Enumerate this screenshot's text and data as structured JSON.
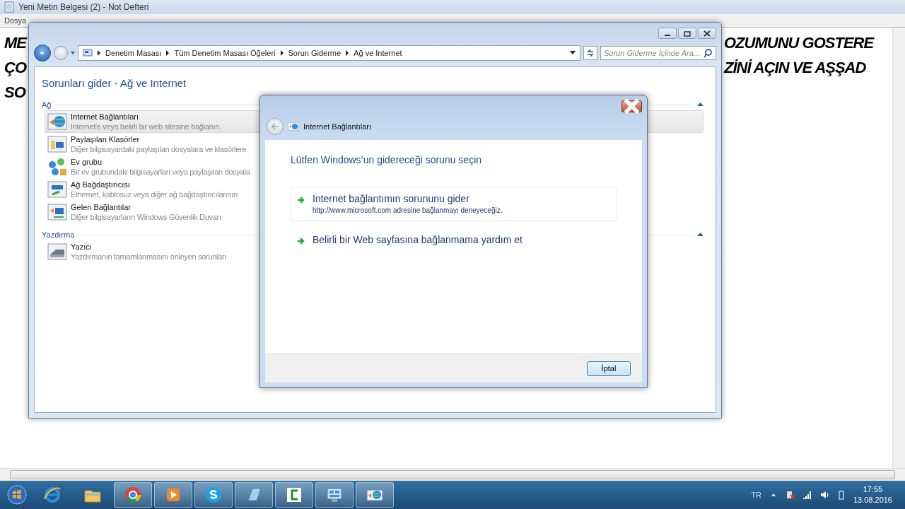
{
  "notepad": {
    "title": "Yeni Metin Belgesi (2) - Not Defteri",
    "menu": [
      "Dosya"
    ],
    "text_left": [
      "ME",
      "ÇO",
      "SO"
    ],
    "text_right": [
      "OZUMUNU GOSTERE",
      "ZİNİ AÇIN VE AŞŞAD"
    ]
  },
  "control_panel": {
    "breadcrumb": [
      "Denetim Masası",
      "Tüm Denetim Masası Öğeleri",
      "Sorun Giderme",
      "Ağ ve Internet"
    ],
    "search": {
      "placeholder": "Sorun Giderme İçinde Ara..."
    },
    "heading": "Sorunları gider - Ağ ve Internet",
    "groups": [
      {
        "title": "Ağ",
        "expanded": true,
        "items": [
          {
            "kind": "internet",
            "title": "Internet Bağlantıları",
            "description": "Internet'e veya belirli bir web sitesine bağlanın.",
            "selected": true
          },
          {
            "kind": "folders",
            "title": "Paylaşılan Klasörler",
            "description": "Diğer bilgisayardaki paylaşılan dosyalara ve klasörlere",
            "selected": false
          },
          {
            "kind": "homegroup",
            "title": "Ev grubu",
            "description": "Bir ev grubundaki bilgisayarları veya paylaşılan dosyala",
            "selected": false
          },
          {
            "kind": "adapter",
            "title": "Ağ Bağdaştırıcısı",
            "description": "Ethernet, kablosuz veya diğer ağ bağdaştırıcılarının",
            "selected": false
          },
          {
            "kind": "incoming",
            "title": "Gelen Bağlantılar",
            "description": "Diğer bilgisayarların Windows Güvenlik Duvarı",
            "selected": false
          }
        ]
      },
      {
        "title": "Yazdırma",
        "expanded": true,
        "items": [
          {
            "kind": "printer",
            "title": "Yazıcı",
            "description": "Yazdırmanın tamamlanmasını önleyen sorunları",
            "selected": false
          }
        ]
      }
    ]
  },
  "dialog": {
    "title": "Internet Bağlantıları",
    "heading": "Lütfen Windows’un gidereceği sorunu seçin",
    "options": [
      {
        "title": "Internet bağlantımın sorununu gider",
        "description": "http://www.microsoft.com adresine bağlanmayı deneyeceğiz.",
        "selected": true
      },
      {
        "title": "Belirli bir Web sayfasına bağlanmama yardım et",
        "selected": false
      }
    ],
    "buttons": [
      "İptal"
    ]
  },
  "taskbar": {
    "apps": [
      {
        "kind": "ie",
        "running": false
      },
      {
        "kind": "explorer",
        "running": false
      },
      {
        "kind": "chrome",
        "running": true
      },
      {
        "kind": "media",
        "running": true
      },
      {
        "kind": "skype",
        "running": true
      },
      {
        "kind": "notepad",
        "running": true
      },
      {
        "kind": "camtasia",
        "running": true
      },
      {
        "kind": "controlpanel",
        "running": true
      },
      {
        "kind": "troubleshoot",
        "running": true
      }
    ],
    "tray": {
      "language": "TR",
      "time": "17:55",
      "date": "13.08.2016"
    }
  }
}
